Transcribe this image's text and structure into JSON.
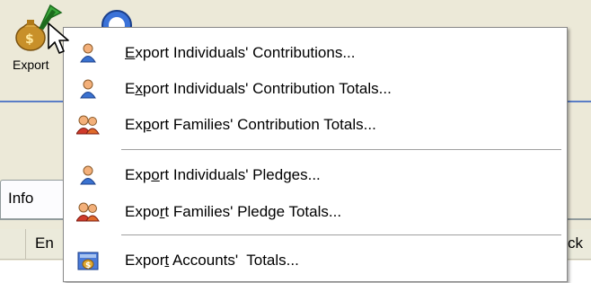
{
  "toolbar": {
    "export_label": "Export",
    "export_icon": "money-bag-export-icon",
    "help_icon": "help-icon"
  },
  "tabs": [
    {
      "label": "Info"
    }
  ],
  "grid": {
    "columns": [
      "En",
      "ck"
    ]
  },
  "context_menu": {
    "items": [
      {
        "pre": "",
        "accel": "E",
        "post": "xport Individuals' Contributions...",
        "icon": "person-icon"
      },
      {
        "pre": "E",
        "accel": "x",
        "post": "port Individuals' Contribution Totals...",
        "icon": "person-icon"
      },
      {
        "pre": "Ex",
        "accel": "p",
        "post": "ort Families' Contribution Totals...",
        "icon": "family-icon"
      },
      {
        "pre": "Exp",
        "accel": "o",
        "post": "rt Individuals' Pledges...",
        "icon": "person-icon"
      },
      {
        "pre": "Expo",
        "accel": "r",
        "post": "t Families' Pledge Totals...",
        "icon": "family-icon"
      },
      {
        "pre": "Expor",
        "accel": "t",
        "post": " Accounts'  Totals...",
        "icon": "accounts-icon"
      }
    ]
  }
}
